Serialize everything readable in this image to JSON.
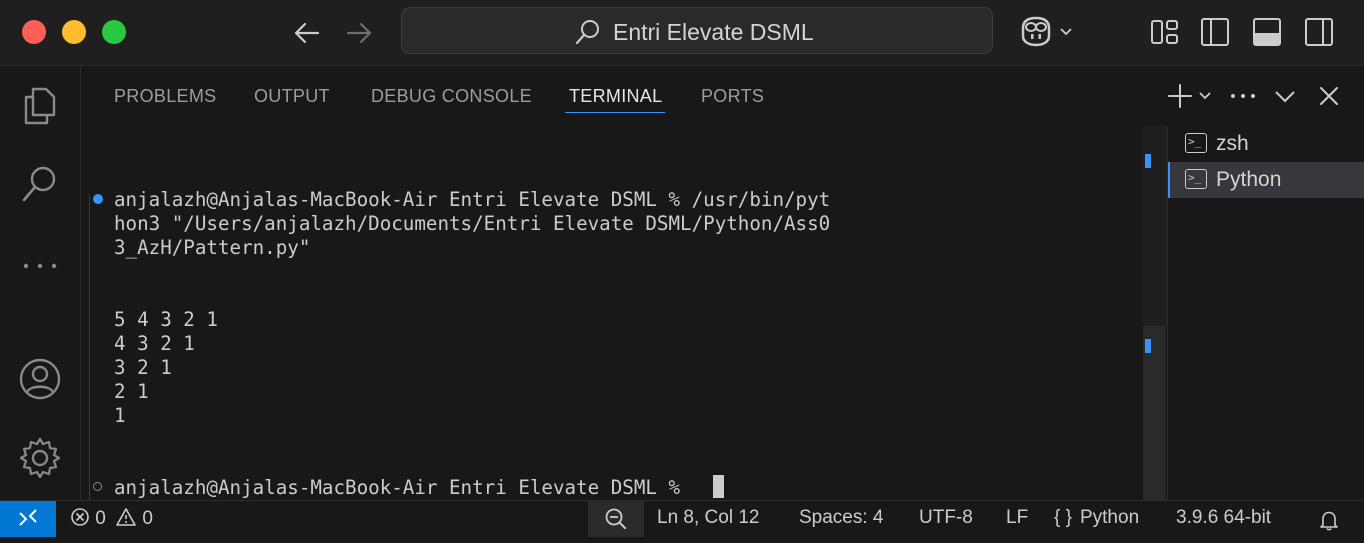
{
  "window": {
    "title": "Entri Elevate DSML"
  },
  "panel": {
    "tabs": [
      {
        "label": "PROBLEMS"
      },
      {
        "label": "OUTPUT"
      },
      {
        "label": "DEBUG CONSOLE"
      },
      {
        "label": "TERMINAL",
        "active": true
      },
      {
        "label": "PORTS"
      }
    ]
  },
  "terminal": {
    "lines": [
      "anjalazh@Anjalas-MacBook-Air Entri Elevate DSML % /usr/bin/pyt",
      "hon3 \"/Users/anjalazh/Documents/Entri Elevate DSML/Python/Ass0",
      "3_AzH/Pattern.py\"",
      "5 4 3 2 1",
      "4 3 2 1",
      "3 2 1",
      "2 1",
      "1",
      "anjalazh@Anjalas-MacBook-Air Entri Elevate DSML % "
    ]
  },
  "terminal_list": {
    "items": [
      {
        "label": "zsh",
        "icon": "terminal-icon"
      },
      {
        "label": "Python",
        "icon": "terminal-icon",
        "active": true
      }
    ]
  },
  "statusbar": {
    "errors": "0",
    "warnings": "0",
    "position": "Ln 8, Col 12",
    "spaces": "Spaces: 4",
    "encoding": "UTF-8",
    "eol": "LF",
    "language": "Python",
    "interpreter": "3.9.6 64-bit"
  },
  "colors": {
    "accent": "#3794ff",
    "remote_bg": "#0078d4",
    "background": "#181818"
  }
}
